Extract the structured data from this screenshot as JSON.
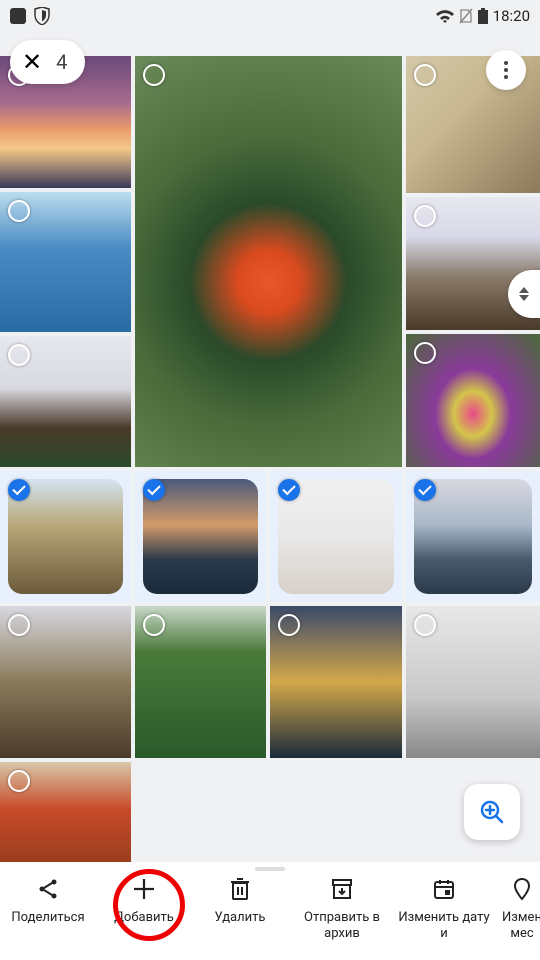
{
  "statusbar": {
    "time": "18:20"
  },
  "selection": {
    "count": "4"
  },
  "actions": {
    "share": "Поделиться",
    "add": "Добавить",
    "delete": "Удалить",
    "archive": "Отправить в архив",
    "date": "Изменить дату и",
    "loc": "Измен мес"
  },
  "tiles": [
    {
      "sel": false
    },
    {
      "sel": false
    },
    {
      "sel": false
    },
    {
      "sel": false
    },
    {
      "sel": false
    },
    {
      "sel": false
    },
    {
      "sel": false
    },
    {
      "sel": true
    },
    {
      "sel": true
    },
    {
      "sel": true
    },
    {
      "sel": true
    },
    {
      "sel": false
    },
    {
      "sel": false
    },
    {
      "sel": false
    },
    {
      "sel": false
    },
    {
      "sel": false
    }
  ]
}
